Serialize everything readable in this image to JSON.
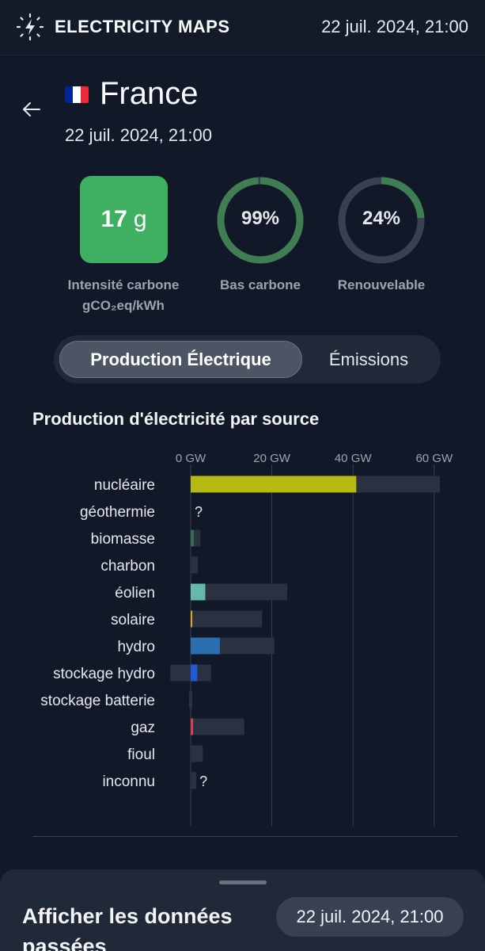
{
  "header": {
    "brand": "ELECTRICITY MAPS",
    "datetime": "22 juil. 2024, 21:00",
    "logo_icon": "bolt-logo-icon"
  },
  "zone": {
    "back_icon": "arrow-left-icon",
    "flag_colors": [
      "#002395",
      "#ffffff",
      "#ed2939"
    ],
    "name": "France",
    "datetime": "22 juil. 2024, 21:00"
  },
  "metrics": {
    "carbon_intensity": {
      "value": "17",
      "unit": "g",
      "label_line1": "Intensité carbone",
      "label_line2": "gCO₂eq/kWh",
      "color": "#3fb061"
    },
    "low_carbon": {
      "value_text": "99%",
      "value": 0.99,
      "label": "Bas carbone",
      "color": "#3f7e52"
    },
    "renewable": {
      "value_text": "24%",
      "value": 0.24,
      "label": "Renouvelable",
      "color": "#3f7e52"
    },
    "ring_track_color": "#374151"
  },
  "tabs": {
    "active": "Production Électrique",
    "inactive": "Émissions"
  },
  "section_title": "Production d'électricité par source",
  "chart_data": {
    "type": "bar",
    "x_unit": "GW",
    "xticks": [
      "0 GW",
      "20 GW",
      "40 GW",
      "60 GW"
    ],
    "xlim": [
      0,
      60
    ],
    "categories": [
      "nucléaire",
      "géothermie",
      "biomasse",
      "charbon",
      "éolien",
      "solaire",
      "hydro",
      "stockage hydro",
      "stockage batterie",
      "gaz",
      "fioul",
      "inconnu"
    ],
    "production_gw": [
      40.8,
      null,
      0.8,
      0,
      3.6,
      0.4,
      7.2,
      1.6,
      0,
      0.6,
      0,
      0
    ],
    "capacity_gw": [
      61.4,
      null,
      2.4,
      1.8,
      23.8,
      17.6,
      20.6,
      5.0,
      0.4,
      13.2,
      3.0,
      1.4
    ],
    "capacity_min_gw": [
      0,
      null,
      0,
      0,
      0,
      0,
      0,
      -5.0,
      -0.4,
      0,
      0,
      0
    ],
    "unknown_marker": "?",
    "unknown_categories": [
      "géothermie",
      "inconnu"
    ],
    "colors": [
      "#b5b912",
      null,
      "#2f6e55",
      "#4b5563",
      "#67b8a8",
      "#e0a030",
      "#2c6fb0",
      "#1f5bd8",
      "#4b5563",
      "#e03a5a",
      "#4b5563",
      "#4b5563"
    ],
    "capacity_color": "#2a3140",
    "grid": true
  },
  "history": {
    "title": "Afficher les données passées",
    "date": "22 juil. 2024, 21:00"
  }
}
